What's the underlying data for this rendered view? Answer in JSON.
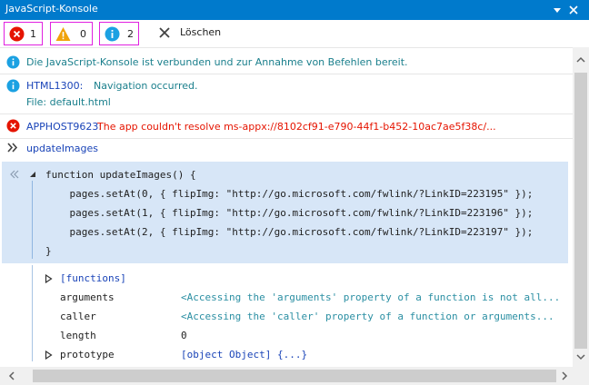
{
  "window": {
    "title": "JavaScript-Konsole"
  },
  "toolbar": {
    "errors_count": "1",
    "warnings_count": "0",
    "info_count": "2",
    "clear_label": "Löschen"
  },
  "messages": [
    {
      "type": "info",
      "text": "Die JavaScript-Konsole ist verbunden und zur Annahme von Befehlen bereit."
    },
    {
      "type": "info",
      "code": "HTML1300:",
      "text": "Navigation occurred.",
      "detail": "File: default.html"
    },
    {
      "type": "error",
      "code": "APPHOST9623:",
      "text": "The app couldn't resolve ms-appx://8102cf91-e790-44f1-b452-10ac7ae5f38c/..."
    },
    {
      "type": "command",
      "text": "updateImages"
    }
  ],
  "code": {
    "lines": [
      "function updateImages() {",
      "    pages.setAt(0, { flipImg: \"http://go.microsoft.com/fwlink/?LinkID=223195\" });",
      "    pages.setAt(1, { flipImg: \"http://go.microsoft.com/fwlink/?LinkID=223196\" });",
      "    pages.setAt(2, { flipImg: \"http://go.microsoft.com/fwlink/?LinkID=223197\" });",
      "}"
    ]
  },
  "properties": [
    {
      "name": "[functions]",
      "value": "",
      "expandable": true
    },
    {
      "name": "arguments",
      "value": "<Accessing the 'arguments' property of a function is not all...",
      "expandable": false
    },
    {
      "name": "caller",
      "value": "<Accessing the 'caller' property of a function or arguments...",
      "expandable": false
    },
    {
      "name": "length",
      "value": "0",
      "expandable": false
    },
    {
      "name": "prototype",
      "value": "[object Object] {...}",
      "expandable": true
    }
  ],
  "colors": {
    "titlebar": "#007acc",
    "info": "#1ba1e2",
    "warning": "#f0a30a",
    "error": "#e51400",
    "filter_border": "#e020e0",
    "code_bg": "#d7e6f7"
  }
}
